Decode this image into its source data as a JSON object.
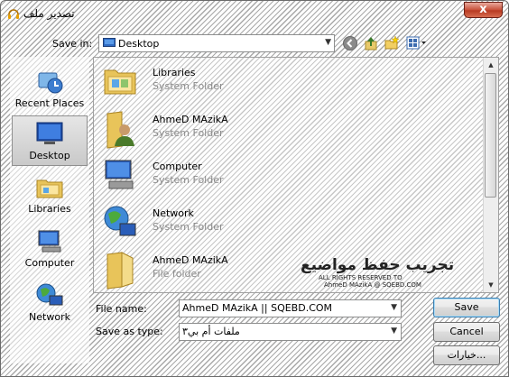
{
  "window": {
    "title": "تصدير ملف",
    "close_label": "x"
  },
  "save_in": {
    "label": "Save in:",
    "value": "Desktop"
  },
  "toolbar": {
    "icons": [
      "back-icon",
      "up-folder-icon",
      "new-folder-icon",
      "views-menu-icon"
    ]
  },
  "places": [
    {
      "label": "Recent Places",
      "icon": "recent-places-icon"
    },
    {
      "label": "Desktop",
      "icon": "desktop-icon",
      "selected": true
    },
    {
      "label": "Libraries",
      "icon": "libraries-icon"
    },
    {
      "label": "Computer",
      "icon": "computer-icon"
    },
    {
      "label": "Network",
      "icon": "network-icon"
    }
  ],
  "files": [
    {
      "name": "Libraries",
      "type": "System Folder",
      "icon": "libraries-icon"
    },
    {
      "name": "AhmeD MAzikA",
      "type": "System Folder",
      "icon": "user-folder-icon"
    },
    {
      "name": "Computer",
      "type": "System Folder",
      "icon": "computer-icon"
    },
    {
      "name": "Network",
      "type": "System Folder",
      "icon": "network-icon"
    },
    {
      "name": "AhmeD MAzikA",
      "type": "File folder",
      "icon": "folder-icon"
    }
  ],
  "watermark": {
    "line1": "تجريب حفظ مواضيع",
    "line2": "ALL RIGHTS RESERVED TO",
    "line3": "AhmeD MAzikA @ SQEBD.COM"
  },
  "file_name": {
    "label": "File name:",
    "value": "AhmeD MAzikA || SQEBD.COM"
  },
  "save_as_type": {
    "label": "Save as type:",
    "value": "ملفات أم بي٣"
  },
  "buttons": {
    "save": "Save",
    "cancel": "Cancel",
    "options": "خيارات..."
  }
}
